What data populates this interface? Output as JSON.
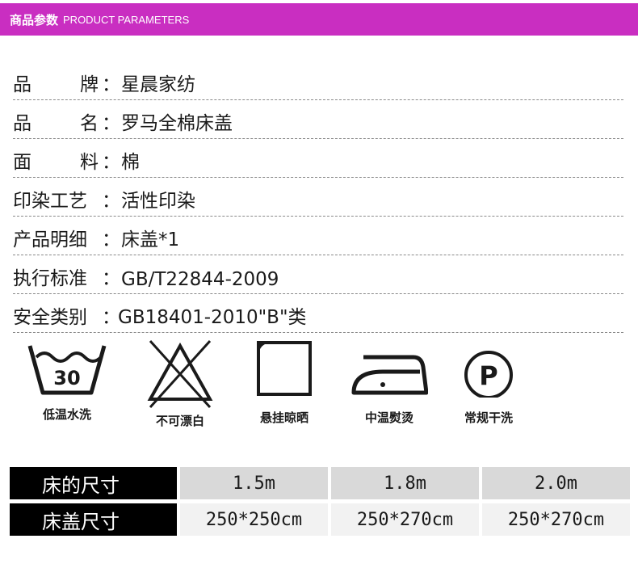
{
  "header": {
    "title_cn": "商品参数",
    "title_en": "PRODUCT PARAMETERS",
    "bg_color": "#c92ec1"
  },
  "params": [
    {
      "label": "品牌",
      "value": "星晨家纺"
    },
    {
      "label": "品名",
      "value": "罗马全棉床盖"
    },
    {
      "label": "面料",
      "value": "棉"
    },
    {
      "label": "印染工艺",
      "value": "活性印染"
    },
    {
      "label": "产品明细",
      "value": "床盖*1"
    },
    {
      "label": "执行标准",
      "value": "GB/T22844-2009"
    },
    {
      "label": "安全类别",
      "value": "GB18401-2010\"B\"类"
    }
  ],
  "care": [
    {
      "icon": "wash-30-icon",
      "label": "低温水洗",
      "temp": "30"
    },
    {
      "icon": "no-bleach-icon",
      "label": "不可漂白"
    },
    {
      "icon": "hang-dry-icon",
      "label": "悬挂晾晒"
    },
    {
      "icon": "iron-medium-icon",
      "label": "中温熨烫"
    },
    {
      "icon": "dry-clean-p-icon",
      "label": "常规干洗",
      "letter": "P"
    }
  ],
  "sizes": {
    "bed_label": "床的尺寸",
    "cover_label": "床盖尺寸",
    "bed_sizes": [
      "1.5m",
      "1.8m",
      "2.0m"
    ],
    "cover_sizes": [
      "250*250cm",
      "250*270cm",
      "250*270cm"
    ]
  }
}
